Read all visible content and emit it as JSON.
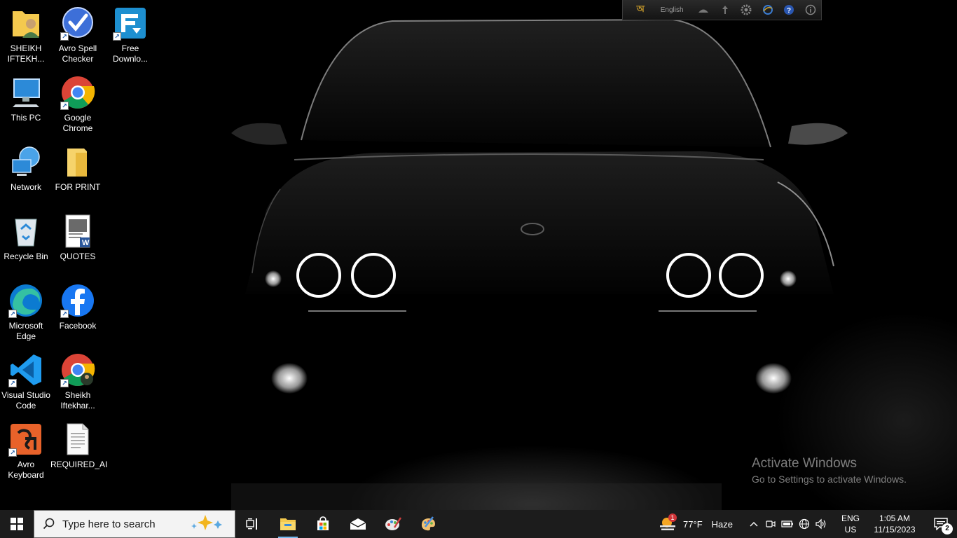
{
  "desktop": {
    "icons": [
      {
        "label": "SHEIKH\nIFTEKH...",
        "icon": "user-folder-icon"
      },
      {
        "label": "Avro Spell\nChecker",
        "icon": "spell-check-icon"
      },
      {
        "label": "Free\nDownlo...",
        "icon": "download-manager-icon"
      },
      {
        "label": "This PC",
        "icon": "computer-icon"
      },
      {
        "label": "Google\nChrome",
        "icon": "chrome-icon"
      },
      {
        "label": "Network",
        "icon": "network-icon"
      },
      {
        "label": "FOR PRINT",
        "icon": "folder-icon"
      },
      {
        "label": "Recycle Bin",
        "icon": "recycle-bin-icon"
      },
      {
        "label": "QUOTES",
        "icon": "word-document-icon"
      },
      {
        "label": "Microsoft\nEdge",
        "icon": "edge-icon"
      },
      {
        "label": "Facebook",
        "icon": "facebook-icon"
      },
      {
        "label": "Visual Studio\nCode",
        "icon": "vscode-icon"
      },
      {
        "label": "Sheikh\nIftekhar...",
        "icon": "chrome-profile-icon"
      },
      {
        "label": "Avro\nKeyboard",
        "icon": "avro-keyboard-icon"
      },
      {
        "label": "REQUIRED_AI",
        "icon": "text-file-icon"
      }
    ]
  },
  "avro_bar": {
    "language": "English"
  },
  "watermark": {
    "title": "Activate Windows",
    "subtitle": "Go to Settings to activate Windows."
  },
  "taskbar": {
    "search_placeholder": "Type here to search",
    "weather": {
      "temp": "77°F",
      "condition": "Haze",
      "badge": "1"
    },
    "language": {
      "line1": "ENG",
      "line2": "US"
    },
    "clock": {
      "time": "1:05 AM",
      "date": "11/15/2023"
    },
    "notification_count": "2"
  },
  "colors": {
    "taskbar_bg": "#1c1c1c",
    "search_bg": "#f3f3f3",
    "active_indicator": "#76b9ed"
  }
}
